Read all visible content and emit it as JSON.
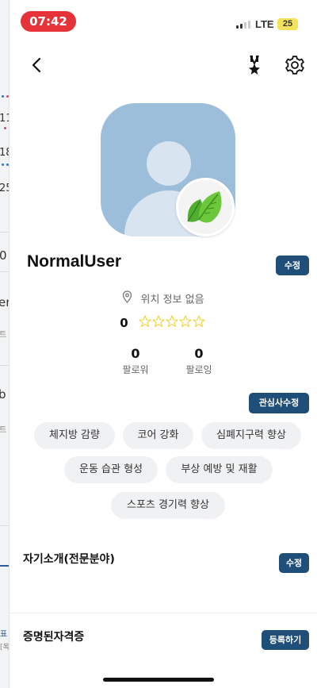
{
  "status_bar": {
    "time": "07:42",
    "network": "LTE",
    "battery": "25"
  },
  "peek": {
    "items": [
      "11",
      "18",
      "25",
      "0",
      "er",
      "트",
      "b",
      "트",
      "표",
      "[복"
    ]
  },
  "nav": {
    "back_icon": "chevron-left-icon",
    "badge_icon": "medal-icon",
    "settings_icon": "gear-icon"
  },
  "profile": {
    "username": "NormalUser",
    "edit_label": "수정",
    "location": "위치 정보 없음",
    "rating": "0",
    "stars": 0,
    "followers_count": "0",
    "followers_label": "팔로워",
    "following_count": "0",
    "following_label": "팔로잉",
    "badge_icon": "leaf-icon"
  },
  "interests": {
    "edit_label": "관심사수정",
    "tags": [
      "체지방 감량",
      "코어 강화",
      "심폐지구력 향상",
      "운동 습관 형성",
      "부상 예방 및 재활",
      "스포츠 경기력 향상"
    ]
  },
  "intro": {
    "title": "자기소개(전문분야)",
    "edit_label": "수정"
  },
  "certificates": {
    "title": "증명된자격증",
    "register_label": "등록하기"
  },
  "colors": {
    "primary": "#1f4e79",
    "time_pill": "#e6333a",
    "avatar_bg": "#9dbedb",
    "chip_bg": "#f0f1f3",
    "star": "#f0d23c"
  }
}
